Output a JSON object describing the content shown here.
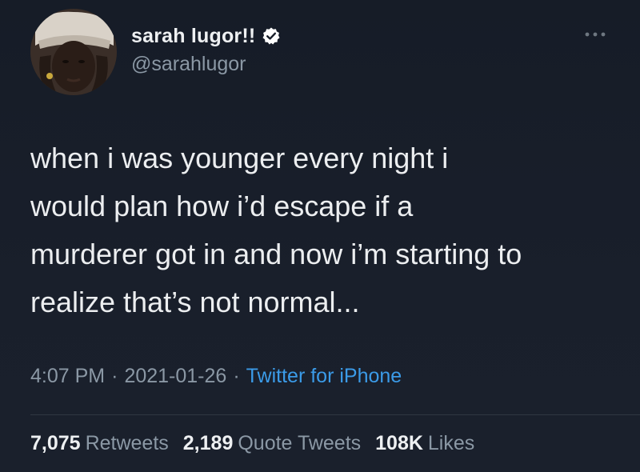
{
  "author": {
    "display_name": "sarah lugor!!",
    "handle": "@sarahlugor",
    "verified": true,
    "avatar_icon": "profile-photo"
  },
  "menu_icon": "more-horizontal-icon",
  "tweet": {
    "text": "when i was younger every night i\nwould plan how i’d escape if a\nmurderer got in and now i’m starting to\nrealize that’s not normal...",
    "time": "4:07 PM",
    "separator": "·",
    "date": "2021-01-26",
    "source": "Twitter for iPhone"
  },
  "stats": {
    "retweets": {
      "value": "7,075",
      "label": "Retweets"
    },
    "quote_tweets": {
      "value": "2,189",
      "label": "Quote Tweets"
    },
    "likes": {
      "value": "108K",
      "label": "Likes"
    }
  },
  "colors": {
    "background": "#171d28",
    "text_primary": "#eceef0",
    "text_secondary": "#8b98a5",
    "link": "#3b9be8",
    "verified_badge": "#ffffff"
  }
}
